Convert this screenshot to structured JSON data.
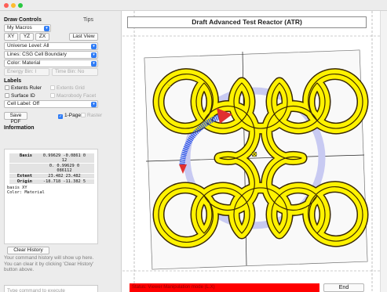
{
  "controls": {
    "title": "Draw Controls",
    "tips": "Tips",
    "macros": "My Macros",
    "views": [
      "XY",
      "YZ",
      "ZX"
    ],
    "last_view": "Last View",
    "universe": "Universe Level: All",
    "lines": "Lines: CSG Cell Boundary",
    "color": "Color: Material",
    "energy_bin": "Energy Bin: I",
    "time_bin": "Time Bin: No"
  },
  "labels": {
    "title": "Labels",
    "extents_ruler": "Extents Ruler",
    "extents_grid": "Extents Grid",
    "surface_id": "Surface ID",
    "macrobody_facet": "Macrobody Facet",
    "cell_label": "Cell Label: Off"
  },
  "save": {
    "save_pdf": "Save PDF",
    "one_page": "1-Page",
    "raster": "Raster"
  },
  "information": {
    "title": "Information",
    "rows": [
      {
        "key": "Basis",
        "values": [
          "0.99629 -0.0861 0",
          "12"
        ]
      },
      {
        "key": "",
        "values": [
          "0.   0.99629 0",
          "086112"
        ]
      },
      {
        "key": "Extent",
        "values": [
          "23.482    23.482"
        ]
      },
      {
        "key": "Origin",
        "values": [
          "-18.718 -11.382 5"
        ]
      }
    ],
    "basis_line": "basis XY",
    "color_line": "Color: Material"
  },
  "history": {
    "clear_label": "Clear History",
    "text": "Your command history will show up here.\nYou can clear it by clicking 'Clear History' button above."
  },
  "command": {
    "placeholder": "Type command to execute"
  },
  "view": {
    "title": "Draft Advanced Test Reactor (ATR)",
    "status": "Status: Viewer Manipulation mode (L.X)",
    "end_label": "End"
  },
  "colors": {
    "ring_fill": "#fff200",
    "ring_outline": "#4a3a00",
    "arrow": "#2f57e8",
    "circle": "#c8caf2",
    "status": "#ff0000"
  }
}
